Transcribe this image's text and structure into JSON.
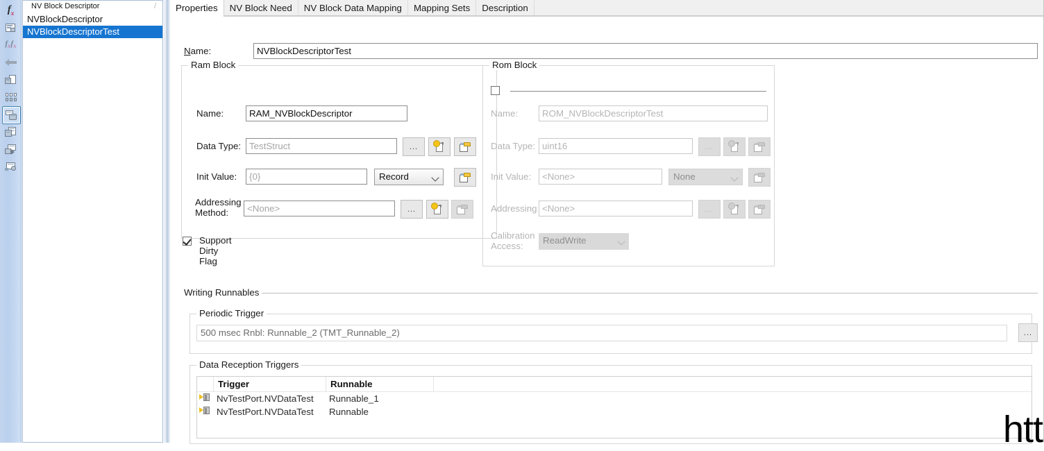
{
  "rail": {
    "items": [
      {
        "name": "function-icon",
        "glyph": "fx",
        "selected": false
      },
      {
        "name": "component-icon",
        "glyph": "panel",
        "selected": false
      },
      {
        "name": "function-pair-icon",
        "glyph": "fxfx",
        "selected": false
      },
      {
        "name": "arrow-left-icon",
        "glyph": "arrow",
        "selected": false
      },
      {
        "name": "document-component-icon",
        "glyph": "doc",
        "selected": false
      },
      {
        "name": "bits-icon",
        "glyph": "bits",
        "selected": false
      },
      {
        "name": "nv-block-descriptor-icon",
        "glyph": "cube",
        "selected": true
      },
      {
        "name": "table-icon",
        "glyph": "table",
        "selected": false
      },
      {
        "name": "mapping-icon",
        "glyph": "map",
        "selected": false
      },
      {
        "name": "settings-component-icon",
        "glyph": "gearbox",
        "selected": false
      }
    ]
  },
  "tree": {
    "header": "NV Block Descriptor",
    "header_mark": "/",
    "items": [
      {
        "label": "NVBlockDescriptor",
        "selected": false
      },
      {
        "label": "NVBlockDescriptorTest",
        "selected": true
      }
    ]
  },
  "tabs": [
    {
      "label": "Properties",
      "active": true
    },
    {
      "label": "NV Block Need",
      "active": false
    },
    {
      "label": "NV Block Data Mapping",
      "active": false
    },
    {
      "label": "Mapping Sets",
      "active": false
    },
    {
      "label": "Description",
      "active": false
    }
  ],
  "name_field": {
    "label_prefix": "N",
    "label_rest": "ame:",
    "value": "NVBlockDescriptorTest"
  },
  "ram_block": {
    "title": "Ram Block",
    "name": {
      "label": "Name:",
      "value": "RAM_NVBlockDescriptor"
    },
    "data_type": {
      "label": "Data Type:",
      "value": "TestStruct"
    },
    "init_value": {
      "label": "Init Value:",
      "value": "{0}",
      "combo": "Record"
    },
    "addressing_method": {
      "label_line1": "Addressing",
      "label_line2": "Method:",
      "value": "<None>"
    },
    "support_dirty_flag": {
      "label": "Support Dirty Flag",
      "checked": true
    },
    "buttons": {
      "ellipsis": "...",
      "new": "new-document-icon",
      "browse": "browse-window-icon"
    }
  },
  "rom_block": {
    "title": "Rom Block",
    "enabled_checkbox": {
      "checked": false
    },
    "name": {
      "label": "Name:",
      "value": "ROM_NVBlockDescriptorTest"
    },
    "data_type": {
      "label": "Data Type:",
      "value": "uint16"
    },
    "init_value": {
      "label": "Init Value:",
      "value": "<None>",
      "combo": "None"
    },
    "addressing_method": {
      "label": "Addressing",
      "value": "<None>"
    },
    "calibration_access": {
      "label_line1": "Calibration",
      "label_line2": "Access:",
      "value": "ReadWrite"
    },
    "buttons": {
      "ellipsis": "...",
      "new": "new-document-icon",
      "browse": "browse-window-icon"
    }
  },
  "writing_runnables": {
    "title": "Writing Runnables",
    "periodic_trigger": {
      "title": "Periodic Trigger",
      "value": "500 msec Rnbl: Runnable_2 (TMT_Runnable_2)",
      "button_label": "..."
    },
    "data_reception_triggers": {
      "title": "Data Reception Triggers",
      "columns": [
        "",
        "Trigger",
        "Runnable",
        ""
      ],
      "rows": [
        {
          "icon": "port-icon",
          "trigger": "NvTestPort.NVDataTest",
          "runnable": "Runnable_1"
        },
        {
          "icon": "port-icon",
          "trigger": "NvTestPort.NVDataTest",
          "runnable": "Runnable"
        }
      ]
    }
  },
  "overlay": {
    "watermark_text": "htt"
  },
  "colors": {
    "selection": "#1675d1",
    "rail_gradient_start": "#c3d5ef",
    "rail_gradient_end": "#cfdff4",
    "group_border": "#d6d6d6",
    "disabled_text": "#b5b5b5"
  }
}
